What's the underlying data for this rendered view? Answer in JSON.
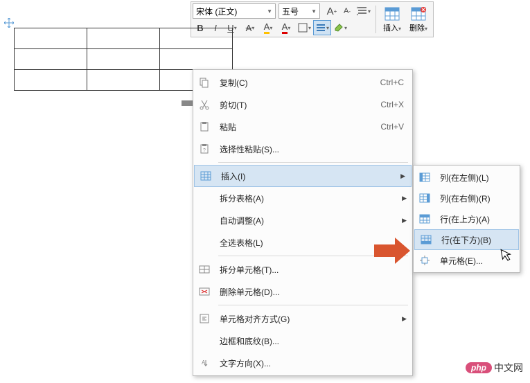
{
  "toolbar": {
    "font_name": "宋体 (正文)",
    "font_size": "五号",
    "bold": "B",
    "italic": "I",
    "underline": "U",
    "strike": "A",
    "highlight": "A",
    "font_color": "A",
    "increase_font": "A⁺",
    "decrease_font": "A⁻",
    "line_spacing": "行距",
    "insert_label": "插入",
    "delete_label": "删除"
  },
  "context_menu": {
    "items": [
      {
        "label": "复制(C)",
        "shortcut": "Ctrl+C"
      },
      {
        "label": "剪切(T)",
        "shortcut": "Ctrl+X"
      },
      {
        "label": "粘贴",
        "shortcut": "Ctrl+V"
      },
      {
        "label": "选择性粘贴(S)...",
        "shortcut": ""
      },
      {
        "label": "插入(I)",
        "shortcut": "",
        "sub": true,
        "hl": true
      },
      {
        "label": "拆分表格(A)",
        "shortcut": "",
        "sub": true
      },
      {
        "label": "自动调整(A)",
        "shortcut": "",
        "sub": true
      },
      {
        "label": "全选表格(L)",
        "shortcut": ""
      },
      {
        "label": "拆分单元格(T)...",
        "shortcut": ""
      },
      {
        "label": "删除单元格(D)...",
        "shortcut": ""
      },
      {
        "label": "单元格对齐方式(G)",
        "shortcut": "",
        "sub": true
      },
      {
        "label": "边框和底纹(B)...",
        "shortcut": ""
      },
      {
        "label": "文字方向(X)...",
        "shortcut": ""
      }
    ]
  },
  "submenu": {
    "items": [
      {
        "label": "列(在左侧)(L)"
      },
      {
        "label": "列(在右侧)(R)"
      },
      {
        "label": "行(在上方)(A)"
      },
      {
        "label": "行(在下方)(B)",
        "hl": true
      },
      {
        "label": "单元格(E)..."
      }
    ]
  },
  "watermark": {
    "pill": "php",
    "text": "中文网"
  }
}
